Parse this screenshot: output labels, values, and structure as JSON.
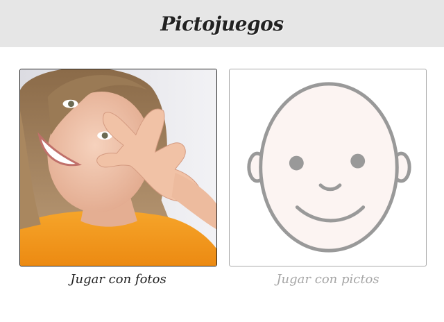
{
  "header": {
    "title": "Pictojuegos"
  },
  "options": {
    "photos_label": "Jugar con fotos",
    "pictos_label": "Jugar con pictos"
  },
  "colors": {
    "header_bg": "#e6e6e6",
    "face_fill": "#fcf4f2",
    "face_stroke": "#999999",
    "shirt": "#f29a1e"
  }
}
